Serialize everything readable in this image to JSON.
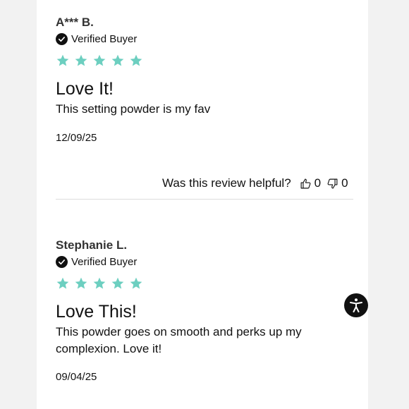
{
  "colors": {
    "star": "#6dcfc0",
    "text": "#111111",
    "divider": "#dddddd",
    "accessibility_button": "#111111"
  },
  "reviews": [
    {
      "author": "A*** B.",
      "verified_label": "Verified Buyer",
      "rating": 5,
      "title": "Love It!",
      "body": "This setting powder is my fav",
      "date": "12/09/25",
      "helpful": {
        "question": "Was this review helpful?",
        "up_count": "0",
        "down_count": "0",
        "up_icon": "thumbs-up-icon",
        "down_icon": "thumbs-down-icon"
      }
    },
    {
      "author": "Stephanie L.",
      "verified_label": "Verified Buyer",
      "rating": 5,
      "title": "Love This!",
      "body": "This powder goes on smooth and perks up my complexion. Love it!",
      "date": "09/04/25"
    }
  ],
  "accessibility_button_icon": "accessibility-icon"
}
